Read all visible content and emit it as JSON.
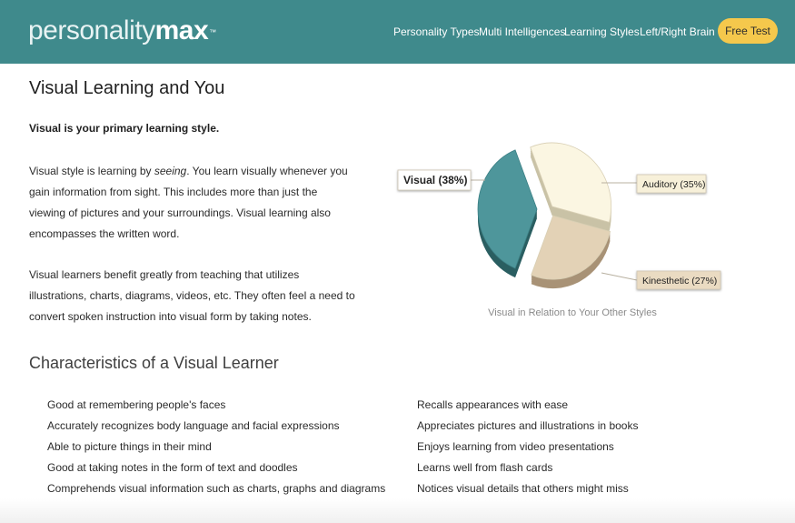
{
  "header": {
    "logo_light": "personality",
    "logo_bold": "max",
    "logo_tm": "™",
    "nav": [
      "Personality Types",
      "Multi Intelligences",
      "Learning Styles",
      "Left/Right Brain"
    ],
    "cta_label": "Free Test"
  },
  "main": {
    "title": "Visual Learning and You",
    "primary_style": "Visual is your primary learning style.",
    "para1_pre": "Visual style is learning by ",
    "para1_em": "seeing",
    "para1_post": ". You learn visually whenever you gain information from sight. This includes more than just the viewing of pictures and your surroundings. Visual learning also encompasses the written word.",
    "para2": "Visual learners benefit greatly from teaching that utilizes illustrations, charts, diagrams, videos, etc. They often feel a need to convert spoken instruction into visual form by taking notes."
  },
  "chart_data": {
    "type": "pie",
    "slices": [
      {
        "label": "Visual (38%)",
        "value": 38,
        "color": "#4e969b"
      },
      {
        "label": "Auditory (35%)",
        "value": 35,
        "color": "#fbf6e2"
      },
      {
        "label": "Kinesthetic (27%)",
        "value": 27,
        "color": "#e3d2b6"
      }
    ],
    "caption": "Visual in Relation to Your Other Styles"
  },
  "characteristics": {
    "title": "Characteristics of a Visual Learner",
    "left": [
      "Good at remembering people's faces",
      "Accurately recognizes body language and facial expressions",
      "Able to picture things in their mind",
      "Good at taking notes in the form of text and doodles",
      "Comprehends visual information such as charts, graphs and diagrams"
    ],
    "right": [
      "Recalls appearances with ease",
      "Appreciates pictures and illustrations in books",
      "Enjoys learning from video presentations",
      "Learns well from flash cards",
      "Notices visual details that others might miss"
    ]
  },
  "colors": {
    "header_bg": "#3f8a8c",
    "cta_bg": "#f5c84c"
  }
}
